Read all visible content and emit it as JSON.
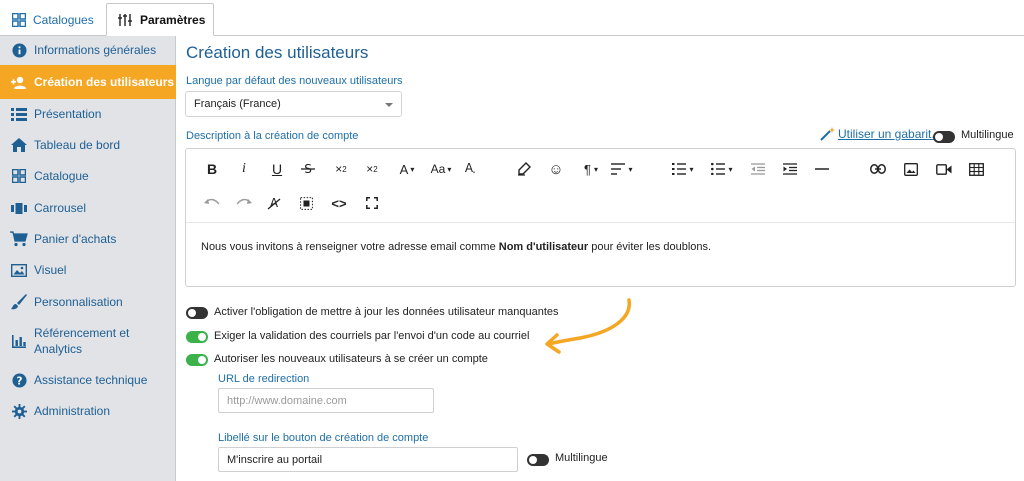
{
  "tabs": [
    {
      "label": "Catalogues",
      "icon": "grid-icon"
    },
    {
      "label": "Paramètres",
      "icon": "sliders-icon"
    }
  ],
  "sidebar": {
    "items": [
      {
        "label": "Informations générales",
        "icon": "info-icon"
      },
      {
        "label": "Création des utilisateurs",
        "icon": "add-user-icon",
        "active": true
      },
      {
        "label": "Présentation",
        "icon": "list-icon"
      },
      {
        "label": "Tableau de bord",
        "icon": "home-icon"
      },
      {
        "label": "Catalogue",
        "icon": "grid-icon"
      },
      {
        "label": "Carrousel",
        "icon": "carousel-icon"
      },
      {
        "label": "Panier d'achats",
        "icon": "cart-icon"
      },
      {
        "label": "Visuel",
        "icon": "image-icon"
      },
      {
        "label": "Personnalisation",
        "icon": "brush-icon"
      },
      {
        "label": "Référencement et",
        "label2": "Analytics",
        "icon": "bar-chart-icon"
      },
      {
        "label": "Assistance technique",
        "icon": "help-icon"
      },
      {
        "label": "Administration",
        "icon": "gear-icon"
      }
    ]
  },
  "main": {
    "title": "Création des utilisateurs",
    "language_label": "Langue par défaut des nouveaux utilisateurs",
    "language_value": "Français (France)",
    "description_label": "Description à la création de compte",
    "template_link": "Utiliser un gabarit...",
    "multilingual_label": "Multilingue",
    "editor": {
      "content_before": "Nous vous invitons à renseigner votre adresse email comme ",
      "content_bold": "Nom d'utilisateur",
      "content_after": " pour éviter les doublons."
    },
    "options": [
      {
        "label": "Activer l'obligation de mettre à jour les données utilisateur manquantes",
        "on": false
      },
      {
        "label": "Exiger la validation des courriels par l'envoi d'un code au courriel",
        "on": true
      },
      {
        "label": "Autoriser les nouveaux utilisateurs à se créer un compte",
        "on": true
      }
    ],
    "redirect_label": "URL de redirection",
    "redirect_placeholder": "http://www.domaine.com",
    "button_label_label": "Libellé sur le bouton de création de compte",
    "button_label_value": "M'inscrire au portail",
    "multilingual_label_2": "Multilingue"
  },
  "colors": {
    "accent": "#f5a623",
    "primary": "#1e6fa8",
    "toggle_on": "#3cb34a",
    "annotation_arrow": "#f5a623"
  }
}
